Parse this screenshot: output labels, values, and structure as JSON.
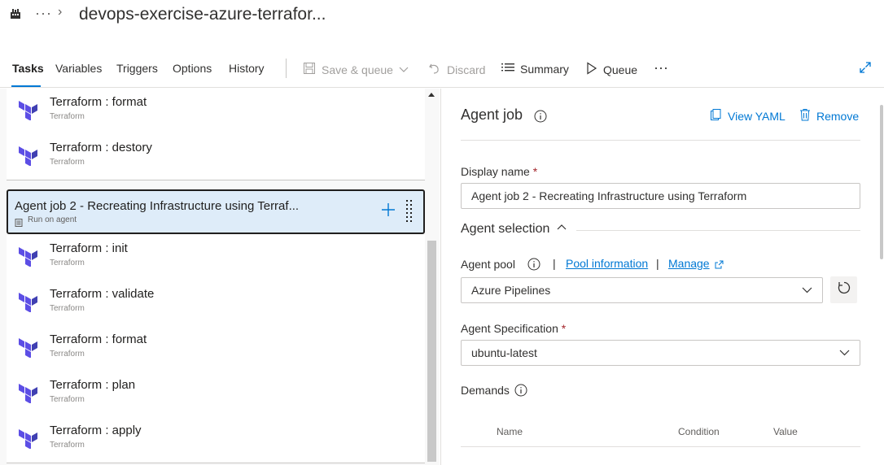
{
  "header": {
    "more": "···",
    "breadcrumb_sep": "›",
    "title": "devops-exercise-azure-terrafor..."
  },
  "toolbar": {
    "tabs": [
      {
        "label": "Tasks",
        "active": true
      },
      {
        "label": "Variables"
      },
      {
        "label": "Triggers"
      },
      {
        "label": "Options"
      },
      {
        "label": "History"
      }
    ],
    "save_queue": "Save & queue",
    "discard": "Discard",
    "summary": "Summary",
    "queue": "Queue",
    "more": "···"
  },
  "pipeline": {
    "job1_tasks": [
      {
        "title": "Terraform : format",
        "sub": "Terraform"
      },
      {
        "title": "Terraform : destory",
        "sub": "Terraform"
      }
    ],
    "agent_job": {
      "title": "Agent job 2 - Recreating Infrastructure using Terraf...",
      "sub": "Run on agent"
    },
    "job2_tasks": [
      {
        "title": "Terraform : init",
        "sub": "Terraform"
      },
      {
        "title": "Terraform : validate",
        "sub": "Terraform"
      },
      {
        "title": "Terraform : format",
        "sub": "Terraform"
      },
      {
        "title": "Terraform : plan",
        "sub": "Terraform"
      },
      {
        "title": "Terraform : apply",
        "sub": "Terraform"
      }
    ]
  },
  "details": {
    "title": "Agent job",
    "view_yaml": "View YAML",
    "remove": "Remove",
    "display_name_label": "Display name",
    "required_mark": "*",
    "display_name_value": "Agent job 2 - Recreating Infrastructure using Terraform",
    "agent_selection": "Agent selection",
    "agent_pool_label": "Agent pool",
    "pipe": "|",
    "pool_information": "Pool information",
    "manage": "Manage",
    "agent_pool_value": "Azure Pipelines",
    "agent_spec_label": "Agent Specification",
    "agent_spec_value": "ubuntu-latest",
    "demands_label": "Demands",
    "columns": [
      "Name",
      "Condition",
      "Value"
    ]
  },
  "colors": {
    "accent": "#0078d4",
    "selected_bg": "#deecf9",
    "terraform_purple": "#5c4ee5",
    "required": "#a4262c"
  }
}
